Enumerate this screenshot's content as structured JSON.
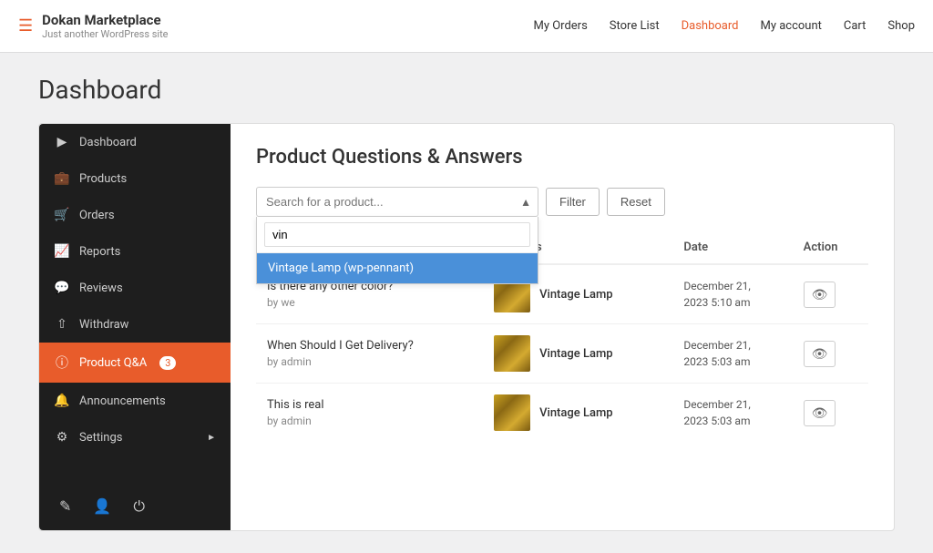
{
  "topbar": {
    "brand_name": "Dokan",
    "brand_name2": "Marketplace",
    "tagline": "Just another WordPress site",
    "nav_items": [
      {
        "label": "My Orders",
        "active": false
      },
      {
        "label": "Store List",
        "active": false
      },
      {
        "label": "Dashboard",
        "active": true
      },
      {
        "label": "My account",
        "active": false
      },
      {
        "label": "Cart",
        "active": false
      },
      {
        "label": "Shop",
        "active": false
      }
    ]
  },
  "page": {
    "title": "Dashboard"
  },
  "sidebar": {
    "items": [
      {
        "label": "Dashboard",
        "icon": "👤",
        "active": false
      },
      {
        "label": "Products",
        "icon": "🧳",
        "active": false
      },
      {
        "label": "Orders",
        "icon": "🛒",
        "active": false
      },
      {
        "label": "Reports",
        "icon": "📈",
        "active": false
      },
      {
        "label": "Reviews",
        "icon": "💬",
        "active": false
      },
      {
        "label": "Withdraw",
        "icon": "⬆",
        "active": false
      },
      {
        "label": "Product Q&A",
        "badge": "3",
        "icon": "❓",
        "active": true
      },
      {
        "label": "Announcements",
        "icon": "🔔",
        "active": false
      },
      {
        "label": "Settings",
        "icon": "⚙",
        "has_arrow": true,
        "active": false
      }
    ],
    "footer_icons": [
      "edit",
      "user",
      "power"
    ]
  },
  "main": {
    "title": "Product Questions & Answers",
    "search_placeholder": "Search for a product...",
    "search_value": "",
    "filter_label": "Filter",
    "reset_label": "Reset",
    "dropdown_input_value": "vin",
    "dropdown_item": "Vintage Lamp (wp-pennant)",
    "table": {
      "columns": [
        "",
        "Products",
        "Date",
        "Action"
      ],
      "rows": [
        {
          "question": "Is there any other color?",
          "by": "by we",
          "product": "Vintage Lamp",
          "date": "December 21,\n2023 5:10 am"
        },
        {
          "question": "When Should I Get Delivery?",
          "by": "by admin",
          "product": "Vintage Lamp",
          "date": "December 21,\n2023 5:03 am"
        },
        {
          "question": "This is real",
          "by": "by admin",
          "product": "Vintage Lamp",
          "date": "December 21,\n2023 5:03 am"
        }
      ]
    }
  }
}
